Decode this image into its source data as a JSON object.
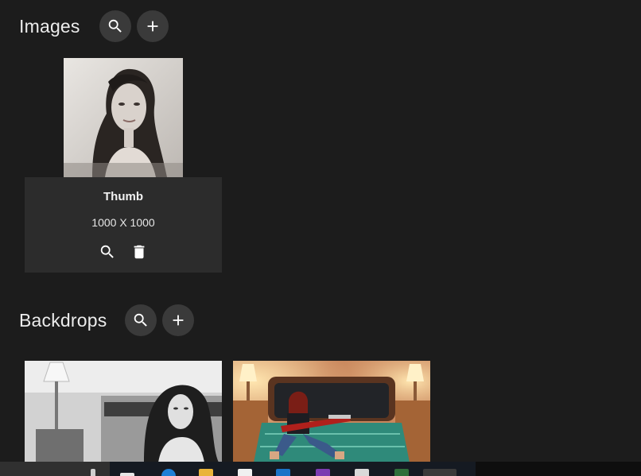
{
  "images_section": {
    "title": "Images",
    "search_icon": "search-icon",
    "add_icon": "add-icon"
  },
  "thumb_card": {
    "title": "Thumb",
    "dimensions": "1000 X 1000",
    "actions": [
      "search-icon",
      "delete-icon"
    ]
  },
  "backdrops_section": {
    "title": "Backdrops",
    "search_icon": "search-icon",
    "add_icon": "add-icon"
  },
  "backdrops": [
    {
      "description_icon": "backdrop-image"
    },
    {
      "description_icon": "backdrop-image"
    }
  ],
  "taskbar": {
    "icons": [
      "search-icon",
      "task-view-icon",
      "edge-icon",
      "file-explorer-icon",
      "store-icon",
      "outlook-icon",
      "onenote-icon",
      "app-icon",
      "app-icon",
      "app-icon"
    ]
  },
  "colors": {
    "background": "#1c1c1c",
    "card_footer": "#2c2c2c",
    "round_button": "#3a3a3a",
    "text": "#ececec"
  }
}
